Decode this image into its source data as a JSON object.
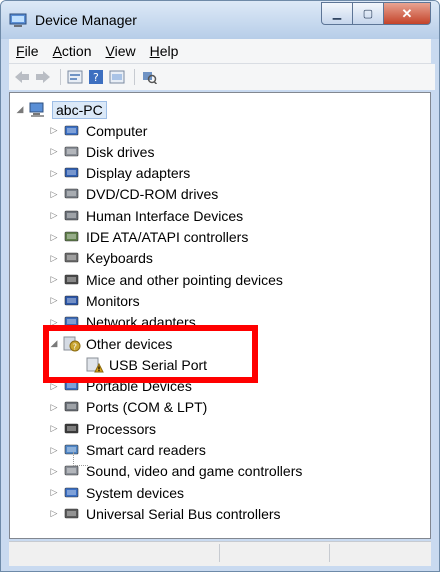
{
  "window": {
    "title": "Device Manager"
  },
  "menu": [
    {
      "label": "File",
      "accel": "F",
      "rest": "ile"
    },
    {
      "label": "Action",
      "accel": "A",
      "rest": "ction"
    },
    {
      "label": "View",
      "accel": "V",
      "rest": "iew"
    },
    {
      "label": "Help",
      "accel": "H",
      "rest": "elp"
    }
  ],
  "toolbar": {
    "icons": [
      "back-icon",
      "forward-icon",
      "properties-icon",
      "help-icon",
      "show-hidden-icon",
      "scan-hardware-icon"
    ]
  },
  "tree": {
    "root": "abc-PC",
    "items": [
      {
        "label": "Computer",
        "icon": "computer-icon",
        "color": "#3b6fc4"
      },
      {
        "label": "Disk drives",
        "icon": "disk-drive-icon",
        "color": "#8a8f97"
      },
      {
        "label": "Display adapters",
        "icon": "display-adapter-icon",
        "color": "#2f5fb3"
      },
      {
        "label": "DVD/CD-ROM drives",
        "icon": "dvd-drive-icon",
        "color": "#7a8088"
      },
      {
        "label": "Human Interface Devices",
        "icon": "hid-icon",
        "color": "#6b7078"
      },
      {
        "label": "IDE ATA/ATAPI controllers",
        "icon": "ide-controller-icon",
        "color": "#5f7e4a"
      },
      {
        "label": "Keyboards",
        "icon": "keyboard-icon",
        "color": "#6c6c6c"
      },
      {
        "label": "Mice and other pointing devices",
        "icon": "mouse-icon",
        "color": "#4a4a4a"
      },
      {
        "label": "Monitors",
        "icon": "monitor-icon",
        "color": "#2a55a8"
      },
      {
        "label": "Network adapters",
        "icon": "network-adapter-icon",
        "color": "#3c6bb8"
      },
      {
        "label": "Other devices",
        "icon": "other-devices-icon",
        "color": "#c9a531",
        "expanded": true
      },
      {
        "label": "USB Serial Port",
        "icon": "warning-device-icon",
        "color": "#d6a21c",
        "child": true
      },
      {
        "label": "Portable Devices",
        "icon": "portable-device-icon",
        "color": "#3b6fc4"
      },
      {
        "label": "Ports (COM & LPT)",
        "icon": "port-icon",
        "color": "#6b7078"
      },
      {
        "label": "Processors",
        "icon": "processor-icon",
        "color": "#3a3a3a"
      },
      {
        "label": "Smart card readers",
        "icon": "smart-card-icon",
        "color": "#4f86c6"
      },
      {
        "label": "Sound, video and game controllers",
        "icon": "sound-icon",
        "color": "#8a8f97"
      },
      {
        "label": "System devices",
        "icon": "system-devices-icon",
        "color": "#3b6fc4"
      },
      {
        "label": "Universal Serial Bus controllers",
        "icon": "usb-icon",
        "color": "#5a5a5a"
      }
    ]
  },
  "colors": {
    "highlight": "#ff0000",
    "title_bar": "#c9daf0"
  }
}
